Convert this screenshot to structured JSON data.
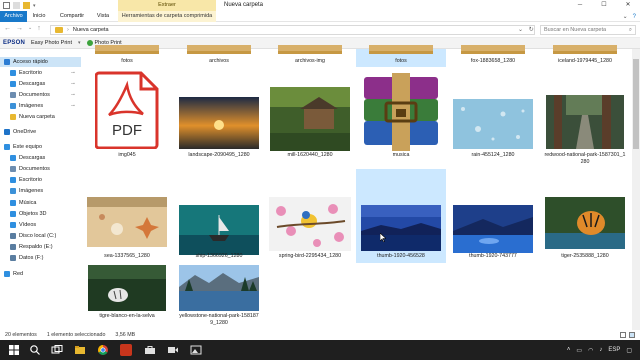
{
  "window": {
    "title": "Nueva carpeta",
    "context_group": "Extraer",
    "minimize": "─",
    "maximize": "☐",
    "close": "✕"
  },
  "ribbon": {
    "tabs": [
      "Archivo",
      "Inicio",
      "Compartir",
      "Vista",
      "Herramientas de carpeta comprimida"
    ],
    "help": "?"
  },
  "address": {
    "path_separator": "›",
    "path": "Nueva carpeta",
    "search_placeholder": "Buscar en Nueva carpeta"
  },
  "epson_bar": {
    "brand": "EPSON",
    "app": "Easy Photo Print",
    "photo_print": "Photo Print"
  },
  "sidebar": {
    "items": [
      {
        "label": "Acceso rápido",
        "icon": "star-icon",
        "color": "#2b7cd3",
        "selected": true
      },
      {
        "label": "Escritorio",
        "icon": "desktop-icon",
        "color": "#2f8fe0",
        "pinned": true
      },
      {
        "label": "Descargas",
        "icon": "download-icon",
        "color": "#2f8fe0",
        "pinned": true
      },
      {
        "label": "Documentos",
        "icon": "documents-icon",
        "color": "#6d8db0",
        "pinned": true
      },
      {
        "label": "Imágenes",
        "icon": "pictures-icon",
        "color": "#3c91d8",
        "pinned": true
      },
      {
        "label": "Nueva carpeta",
        "icon": "folder-icon",
        "color": "#e8b830"
      },
      {
        "label": "OneDrive",
        "icon": "cloud-icon",
        "color": "#1e73c8"
      },
      {
        "label": "Este equipo",
        "icon": "computer-icon",
        "color": "#2f8fe0"
      },
      {
        "label": "Descargas",
        "icon": "download-icon",
        "color": "#2f8fe0"
      },
      {
        "label": "Documentos",
        "icon": "documents-icon",
        "color": "#6d8db0"
      },
      {
        "label": "Escritorio",
        "icon": "desktop-icon",
        "color": "#2f8fe0"
      },
      {
        "label": "Imágenes",
        "icon": "pictures-icon",
        "color": "#3c91d8"
      },
      {
        "label": "Música",
        "icon": "music-icon",
        "color": "#2f8fe0"
      },
      {
        "label": "Objetos 3D",
        "icon": "cube-icon",
        "color": "#2f8fe0"
      },
      {
        "label": "Vídeos",
        "icon": "video-icon",
        "color": "#2f8fe0"
      },
      {
        "label": "Disco local (C:)",
        "icon": "drive-icon",
        "color": "#5a7da0"
      },
      {
        "label": "Respaldo (E:)",
        "icon": "drive-icon",
        "color": "#5a7da0"
      },
      {
        "label": "Datos (F:)",
        "icon": "drive-icon",
        "color": "#5a7da0"
      },
      {
        "label": "Red",
        "icon": "network-icon",
        "color": "#2f8fe0"
      }
    ]
  },
  "files": {
    "row0": [
      "fotos",
      "archivos",
      "archivos-img",
      "fotos",
      "fox-1883658_1280",
      "iceland-1979445_1280"
    ],
    "row1": [
      "img045",
      "landscape-2090495_1280",
      "mill-1620440_1280",
      "musica",
      "rain-455124_1280",
      "redwood-national-park-1587301_1280"
    ],
    "row2": [
      "sea-1337565_1280",
      "ship-1366926_1280",
      "spring-bird-2295434_1280",
      "thumb-1920-456528",
      "thumb-1920-743777",
      "tiger-2535888_1280"
    ],
    "row3": [
      "tigre-blanco-en-la-selva",
      "yellowstone-national-park-1581879_1280"
    ],
    "pdf_label": "PDF"
  },
  "status": {
    "count": "20 elementos",
    "selection": "1 elemento seleccionado",
    "size": "3,56 MB"
  },
  "taskbar": {
    "language": "ESP",
    "apps": [
      "start-icon",
      "search-icon",
      "task-view-icon",
      "file-explorer-icon",
      "chrome-icon",
      "app-red-icon",
      "briefcase-icon",
      "video-icon",
      "photos-icon"
    ]
  }
}
